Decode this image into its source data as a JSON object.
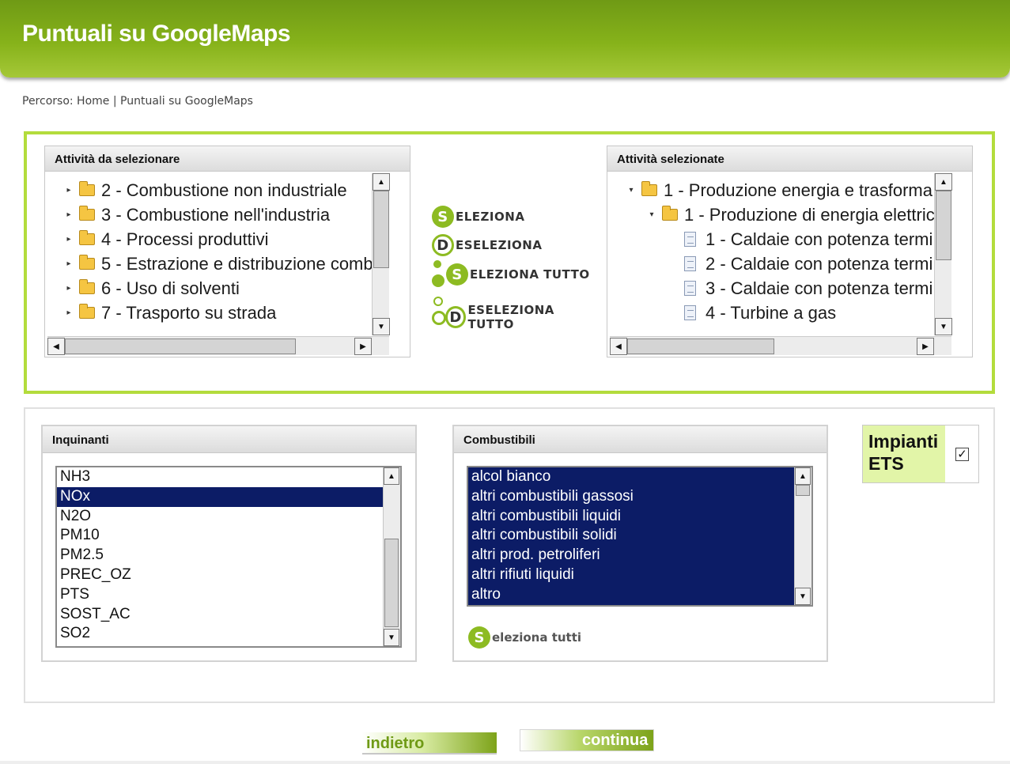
{
  "header": {
    "title": "Puntuali su GoogleMaps"
  },
  "breadcrumb": "Percorso: Home | Puntuali su GoogleMaps",
  "activities_available": {
    "title": "Attività da selezionare",
    "items": [
      "2 - Combustione non industriale",
      "3 - Combustione nell'industria",
      "4 - Processi produttivi",
      "5 - Estrazione e distribuzione comb",
      "6 - Uso di solventi",
      "7 - Trasporto su strada"
    ]
  },
  "activities_selected": {
    "title": "Attività selezionate",
    "items": [
      "1 - Produzione energia e trasforma",
      "1 - Produzione di energia elettric",
      "1 - Caldaie con potenza termi",
      "2 - Caldaie con potenza termi",
      "3 - Caldaie con potenza termi",
      "4 - Turbine a gas"
    ]
  },
  "actions": {
    "select": {
      "letter": "S",
      "rest": "ELEZIONA"
    },
    "deselect": {
      "letter": "D",
      "rest": "ESELEZIONA"
    },
    "select_all": {
      "letter": "S",
      "rest": "ELEZIONA TUTTO"
    },
    "deselect_all": {
      "letter": "D",
      "rest": "ESELEZIONA TUTTO"
    }
  },
  "pollutants": {
    "title": "Inquinanti",
    "items": [
      "NH3",
      "NOx",
      "N2O",
      "PM10",
      "PM2.5",
      "PREC_OZ",
      "PTS",
      "SOST_AC",
      "SO2"
    ],
    "selected": "NOx"
  },
  "fuels": {
    "title": "Combustibili",
    "items": [
      "alcol bianco",
      "altri combustibili gassosi",
      "altri combustibili liquidi",
      "altri combustibili solidi",
      "altri prod. petroliferi",
      "altri rifiuti liquidi",
      "altro"
    ],
    "select_all": {
      "letter": "S",
      "rest": "eleziona tutti"
    }
  },
  "ets": {
    "label_line1": "Impianti",
    "label_line2": "ETS",
    "checked": true,
    "check_glyph": "✓"
  },
  "nav": {
    "back": "indietro",
    "next": "continua"
  },
  "colors": {
    "accent": "#8dbb22",
    "header": "#7da319",
    "selection": "#0c1c66",
    "panel_border": "#b3dc3c"
  }
}
